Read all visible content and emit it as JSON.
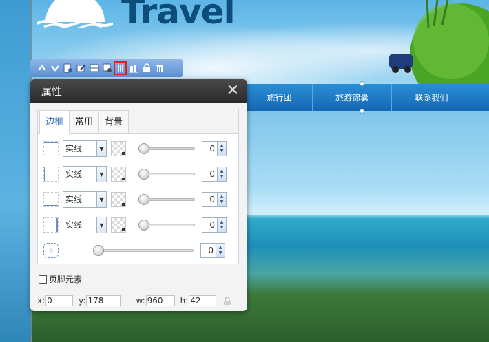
{
  "site": {
    "brand": "Travel",
    "nav": [
      "旅行团",
      "旅游锦囊",
      "联系我们"
    ]
  },
  "toolbar": {
    "buttons": [
      {
        "icon": "move-up-icon"
      },
      {
        "icon": "move-down-icon"
      },
      {
        "icon": "page-settings-icon"
      },
      {
        "icon": "edit-icon"
      },
      {
        "icon": "layout-icon"
      },
      {
        "icon": "module-settings-icon"
      },
      {
        "icon": "properties-icon",
        "active": true
      },
      {
        "icon": "align-icon"
      },
      {
        "icon": "unlock-icon"
      },
      {
        "icon": "delete-icon"
      }
    ]
  },
  "dialog": {
    "title": "属性",
    "close": "✕",
    "tabs": [
      {
        "label": "边框",
        "active": true
      },
      {
        "label": "常用"
      },
      {
        "label": "背景"
      }
    ],
    "border_rows": [
      {
        "side": "top",
        "style": "实线",
        "width": "0"
      },
      {
        "side": "left",
        "style": "实线",
        "width": "0"
      },
      {
        "side": "bottom",
        "style": "实线",
        "width": "0"
      },
      {
        "side": "right",
        "style": "实线",
        "width": "0"
      }
    ],
    "radius": {
      "value": "0"
    },
    "footer_element_label": "页脚元素",
    "footer_element_checked": false,
    "coords": {
      "x_label": "x:",
      "x": "0",
      "y_label": "y:",
      "y": "178",
      "w_label": "w:",
      "w": "960",
      "h_label": "h:",
      "h": "42"
    }
  },
  "colors": {
    "nav_bar": "#1a74bf",
    "brand_text": "#0d4d7a",
    "dialog_header": "#333333",
    "active_tab": "#2e6fb7",
    "active_toolbar_outline": "#e02020"
  }
}
